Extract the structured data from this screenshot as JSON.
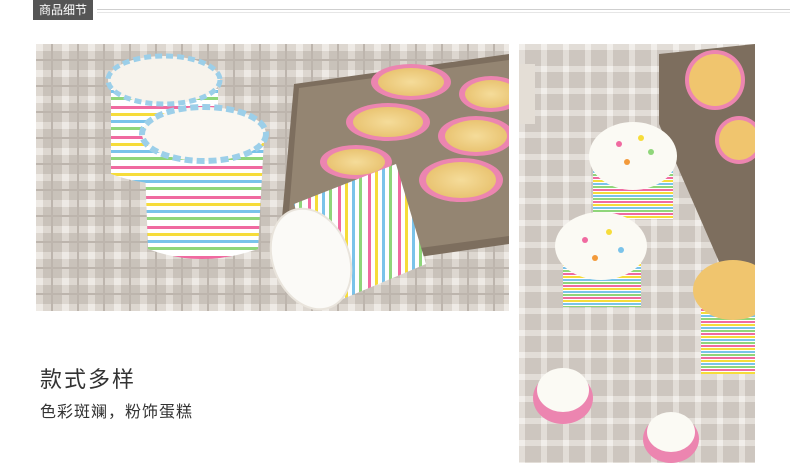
{
  "header": {
    "tag_label": "商品细节"
  },
  "caption": {
    "title": "款式多样",
    "subtitle": "色彩斑斓，粉饰蛋糕"
  },
  "images": {
    "left": {
      "subject": "striped paper cupcake liners beside a muffin tin"
    },
    "right": {
      "subject": "cupcakes with cream and sprinkles in striped liners"
    }
  },
  "colors": {
    "tag_background": "#555555",
    "tag_text": "#ffffff",
    "text": "#333333",
    "tablecloth": "#cfc8c1",
    "tin": "#8a7a68",
    "cake": "#f2d489",
    "cream": "#fbfaf4",
    "stripe_pink": "#f06aa0",
    "stripe_yellow": "#f6dc3a",
    "stripe_blue": "#7ac3ea",
    "stripe_green": "#8fd67a"
  }
}
